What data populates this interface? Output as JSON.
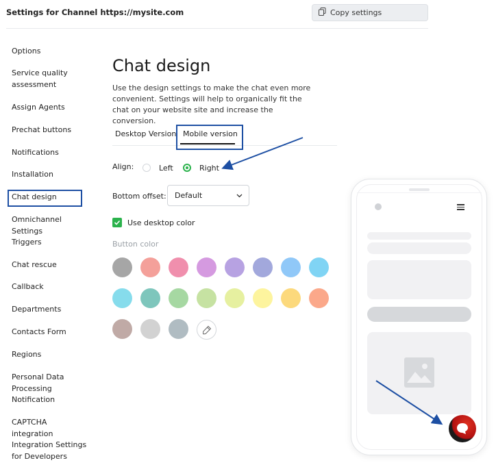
{
  "header": {
    "title": "Settings for Channel https://mysite.com",
    "copy_button_label": "Copy settings"
  },
  "sidebar": {
    "items": [
      {
        "label": "Options"
      },
      {
        "label": "Service quality assessment"
      },
      {
        "label": "Assign Agents"
      },
      {
        "label": "Prechat buttons"
      },
      {
        "label": "Notifications"
      },
      {
        "label": "Installation"
      },
      {
        "label": "Chat design",
        "active": true
      },
      {
        "label": "Omnichannel Settings"
      },
      {
        "label": "Triggers"
      },
      {
        "label": "Chat rescue"
      },
      {
        "label": "Callback"
      },
      {
        "label": "Departments"
      },
      {
        "label": "Contacts Form"
      },
      {
        "label": "Regions"
      },
      {
        "label": "Personal Data Processing Notification"
      },
      {
        "label": "CAPTCHA integration"
      },
      {
        "label": "Integration Settings for Developers"
      }
    ]
  },
  "main": {
    "heading": "Chat design",
    "description": "Use the design settings to make the chat even more convenient. Settings will help to organically fit the chat on your website site and increase the conversion.",
    "tabs": [
      {
        "label": "Desktop Version"
      },
      {
        "label": "Mobile version",
        "active": true
      }
    ],
    "align": {
      "label": "Align:",
      "options": [
        "Left",
        "Right"
      ],
      "selected": "Right"
    },
    "bottom_offset": {
      "label": "Bottom offset:",
      "value": "Default"
    },
    "use_desktop_color": {
      "label": "Use desktop color",
      "checked": true
    },
    "button_color": {
      "label": "Button color",
      "swatches": [
        "#a6a6a6",
        "#f4a09a",
        "#f08fad",
        "#d59ae0",
        "#b7a2e2",
        "#a2a8dc",
        "#90c8f8",
        "#80d4f4",
        "#86dcec",
        "#7ec6bc",
        "#a6d8a2",
        "#c6e2a2",
        "#e6f0a0",
        "#fdf49e",
        "#fcd97c",
        "#fba88a",
        "#c0aaa6",
        "#d2d2d2",
        "#b0bcc2"
      ]
    }
  },
  "icons": {
    "copy": "copy-icon",
    "chevron": "chevron-down-icon",
    "check": "check-icon",
    "eyedropper": "eyedropper-icon",
    "menu": "hamburger-icon",
    "image": "image-placeholder-icon",
    "chat": "chat-bubble-icon"
  },
  "colors": {
    "accent_green": "#2bb24c",
    "annotation_blue": "#1d4fa3"
  }
}
